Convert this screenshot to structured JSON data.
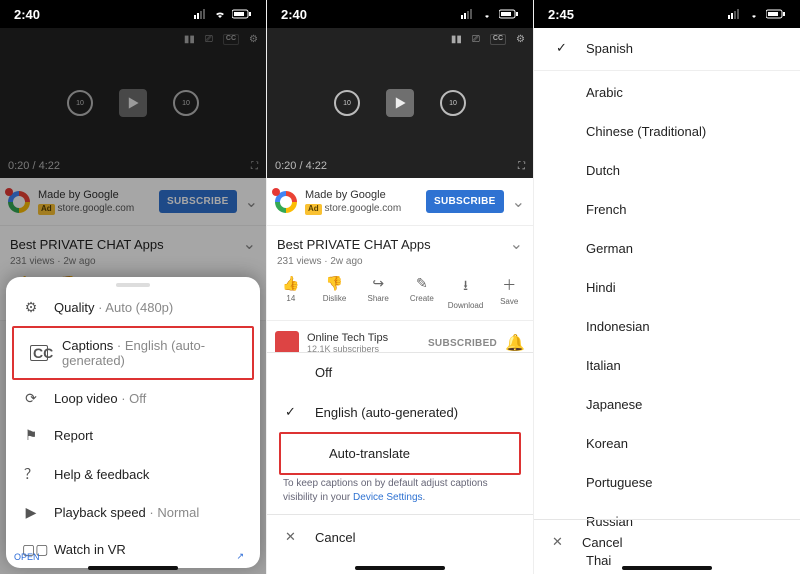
{
  "status": {
    "time_a": "2:40",
    "time_b": "2:40",
    "time_c": "2:45"
  },
  "player": {
    "time": "0:20 / 4:22"
  },
  "ad": {
    "title": "Made by Google",
    "tag": "Ad",
    "sub": "store.google.com",
    "subscribe": "SUBSCRIBE"
  },
  "video": {
    "title": "Best PRIVATE CHAT Apps",
    "meta": "231 views · 2w ago"
  },
  "actions": {
    "like": "14",
    "dislike": "Dislike",
    "share": "Share",
    "create": "Create",
    "download": "Download",
    "save": "Save"
  },
  "channel": {
    "name": "Online Tech Tips",
    "subs": "12.1K subscribers",
    "state": "SUBSCRIBED"
  },
  "sheet1": {
    "quality_label": "Quality",
    "quality_value": " · Auto (480p)",
    "captions_label": "Captions",
    "captions_value": " · English (auto-generated)",
    "loop_label": "Loop video",
    "loop_value": " · Off",
    "report": "Report",
    "help": "Help & feedback",
    "speed_label": "Playback speed",
    "speed_value": " · Normal",
    "vr": "Watch in VR",
    "open": "OPEN"
  },
  "sheet2": {
    "off": "Off",
    "english": "English (auto-generated)",
    "auto": "Auto-translate",
    "hint_a": "To keep captions on by default adjust captions visibility in your ",
    "hint_link": "Device Settings",
    "hint_b": ".",
    "cancel": "Cancel"
  },
  "langs": {
    "selected": "Spanish",
    "items": [
      "Arabic",
      "Chinese (Traditional)",
      "Dutch",
      "French",
      "German",
      "Hindi",
      "Indonesian",
      "Italian",
      "Japanese",
      "Korean",
      "Portuguese",
      "Russian",
      "Thai"
    ],
    "cancel": "Cancel"
  }
}
